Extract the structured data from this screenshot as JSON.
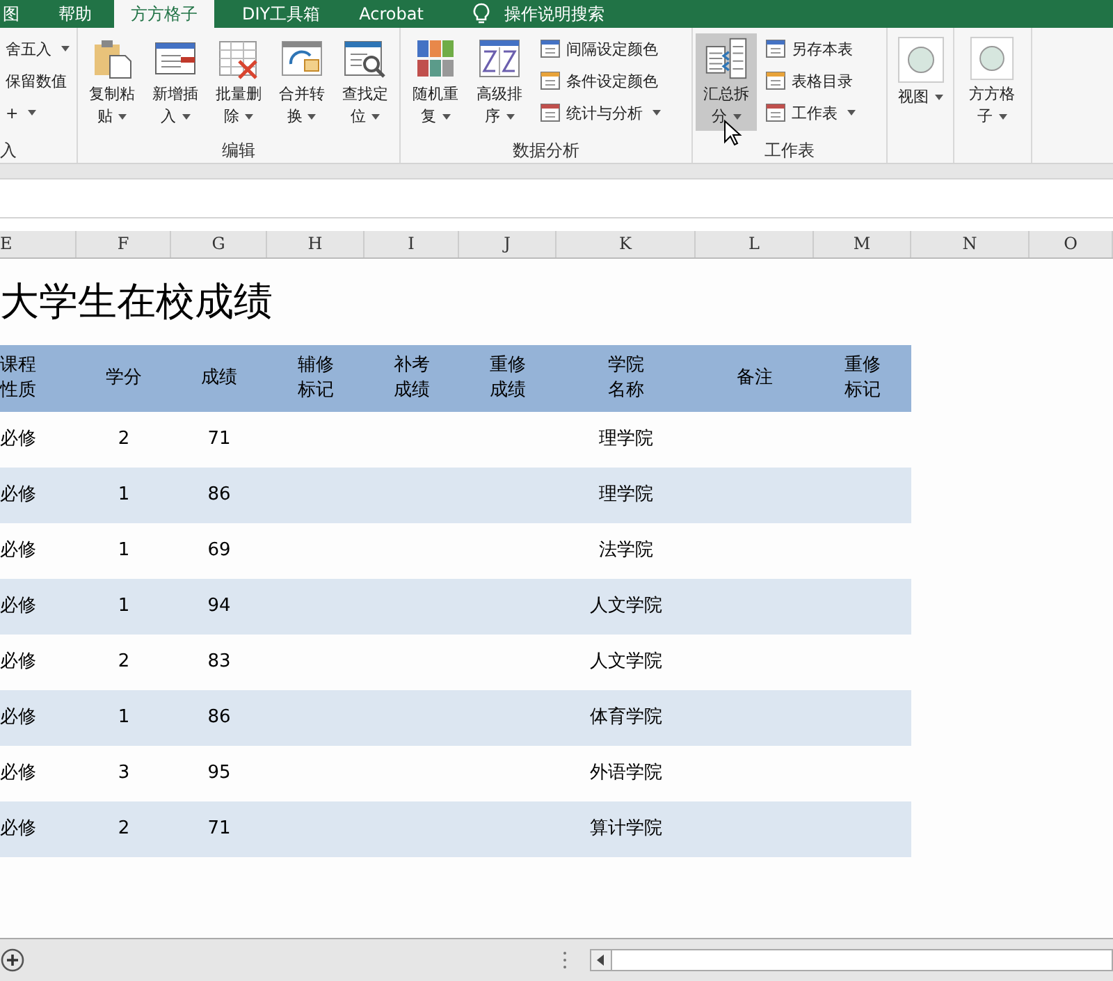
{
  "tabs": [
    {
      "label": "图",
      "selected": false
    },
    {
      "label": "帮助",
      "selected": false
    },
    {
      "label": "方方格子",
      "selected": true
    },
    {
      "label": "DIY工具箱",
      "selected": false
    },
    {
      "label": "Acrobat",
      "selected": false
    }
  ],
  "tell_me": "操作说明搜索",
  "ribbon_groups": [
    {
      "label": "入",
      "small_buttons": [
        {
          "label": "舍五入",
          "dropdown": true
        },
        {
          "label": "保留数值",
          "dropdown": false
        },
        {
          "label": "+",
          "dropdown": true
        }
      ]
    },
    {
      "label": "编辑",
      "large_buttons": [
        {
          "label": "复制粘贴",
          "dropdown": true,
          "hovered": false
        },
        {
          "label": "新增插入",
          "dropdown": true,
          "hovered": false
        },
        {
          "label": "批量删除",
          "dropdown": true,
          "hovered": false
        },
        {
          "label": "合并转换",
          "dropdown": true,
          "hovered": false
        },
        {
          "label": "查找定位",
          "dropdown": true,
          "hovered": false
        }
      ]
    },
    {
      "label": "数据分析",
      "large_buttons": [
        {
          "label": "随机重复",
          "dropdown": true,
          "hovered": false
        },
        {
          "label": "高级排序",
          "dropdown": true,
          "hovered": false
        }
      ],
      "small_buttons": [
        {
          "label": "间隔设定颜色",
          "dropdown": false
        },
        {
          "label": "条件设定颜色",
          "dropdown": false
        },
        {
          "label": "统计与分析",
          "dropdown": true
        }
      ]
    },
    {
      "label": "工作表",
      "large_buttons": [
        {
          "label": "汇总拆分",
          "dropdown": true,
          "hovered": true
        }
      ],
      "small_buttons": [
        {
          "label": "另存本表",
          "dropdown": false
        },
        {
          "label": "表格目录",
          "dropdown": false
        },
        {
          "label": "工作表",
          "dropdown": true
        }
      ]
    },
    {
      "large_buttons": [
        {
          "label": "视图",
          "dropdown": true,
          "hovered": false
        }
      ]
    },
    {
      "large_buttons": [
        {
          "label": "方方格子",
          "dropdown": true,
          "hovered": false
        }
      ]
    }
  ],
  "columns": [
    "E",
    "F",
    "G",
    "H",
    "I",
    "J",
    "K",
    "L",
    "M",
    "N",
    "O"
  ],
  "sheet_title": "大学生在校成绩",
  "table_headers": [
    "课程性质",
    "学分",
    "成绩",
    "辅修标记",
    "补考成绩",
    "重修成绩",
    "学院名称",
    "备注",
    "重修标记"
  ],
  "rows": [
    [
      "必修",
      "2",
      "71",
      "",
      "",
      "",
      "理学院",
      "",
      ""
    ],
    [
      "必修",
      "1",
      "86",
      "",
      "",
      "",
      "理学院",
      "",
      ""
    ],
    [
      "必修",
      "1",
      "69",
      "",
      "",
      "",
      "法学院",
      "",
      ""
    ],
    [
      "必修",
      "1",
      "94",
      "",
      "",
      "",
      "人文学院",
      "",
      ""
    ],
    [
      "必修",
      "2",
      "83",
      "",
      "",
      "",
      "人文学院",
      "",
      ""
    ],
    [
      "必修",
      "1",
      "86",
      "",
      "",
      "",
      "体育学院",
      "",
      ""
    ],
    [
      "必修",
      "3",
      "95",
      "",
      "",
      "",
      "外语学院",
      "",
      ""
    ],
    [
      "必修",
      "2",
      "71",
      "",
      "",
      "",
      "算计学院",
      "",
      ""
    ]
  ]
}
